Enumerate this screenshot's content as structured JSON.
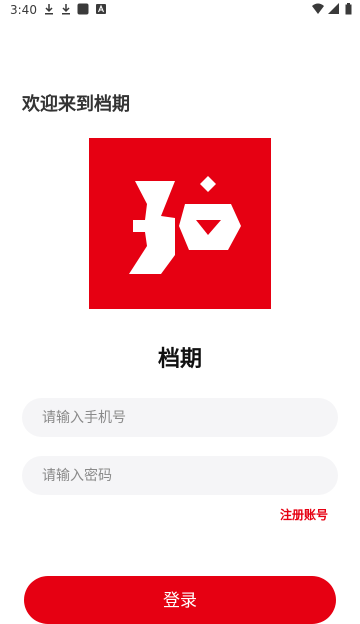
{
  "status_bar": {
    "time": "3:40",
    "icons": [
      "download-icon",
      "download-icon",
      "app-square-icon",
      "a-icon",
      "wifi-icon",
      "signal-icon",
      "battery-icon"
    ]
  },
  "welcome_text": "欢迎来到档期",
  "logo": {
    "name": "dangqi-logo",
    "color": "#e60012"
  },
  "app_name": "档期",
  "form": {
    "phone_placeholder": "请输入手机号",
    "password_placeholder": "请输入密码",
    "phone_value": "",
    "password_value": ""
  },
  "register_label": "注册账号",
  "login_label": "登录",
  "colors": {
    "accent": "#e60012",
    "input_bg": "#f5f5f7"
  }
}
